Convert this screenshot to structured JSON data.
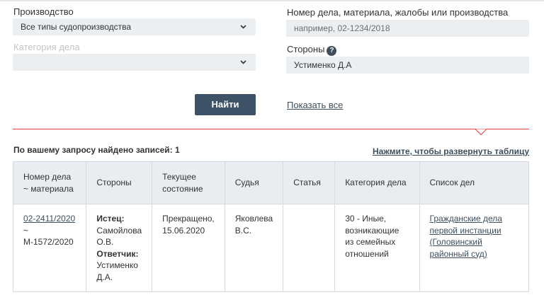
{
  "search_form": {
    "proceeding": {
      "label": "Производство",
      "value": "Все типы судопроизводства"
    },
    "case_category": {
      "label": "Категория дела",
      "value": ""
    },
    "case_number": {
      "label": "Номер дела, материала, жалобы или производства",
      "placeholder": "например, 02-1234/2018"
    },
    "parties": {
      "label": "Стороны",
      "help_icon": "?",
      "value": "Устименко Д.А"
    },
    "find_button": "Найти",
    "show_all_link": "Показать все"
  },
  "results": {
    "count_text": "По вашему запросу найдено записей: 1",
    "expand_link": "Нажмите, чтобы развернуть таблицу",
    "columns": [
      "Номер дела ~ материала",
      "Стороны",
      "Текущее состояние",
      "Судья",
      "Статья",
      "Категория дела",
      "Список дел"
    ],
    "rows": [
      {
        "case_number_link": "02-2411/2020",
        "case_number_sep": "~",
        "material_number": "М-1572/2020",
        "plaintiff_label": "Истец:",
        "plaintiff_name": "Самойлова О.В.",
        "defendant_label": "Ответчик:",
        "defendant_name": "Устименко Д.А.",
        "status": "Прекращено, 15.06.2020",
        "judge": "Яковлева В.С.",
        "article": "",
        "category": "30 - Иные, возникающие из семейных отношений",
        "case_list_link": "Гражданские дела первой инстанции (Головинский районный суд)"
      }
    ]
  },
  "colors": {
    "accent_line": "#e0463a",
    "button_bg": "#3d5266",
    "field_bg": "#ebeff2",
    "header_bg": "#e9edf1"
  },
  "icons": {
    "dropdown": "chevron-down-icon",
    "help": "help-icon"
  }
}
